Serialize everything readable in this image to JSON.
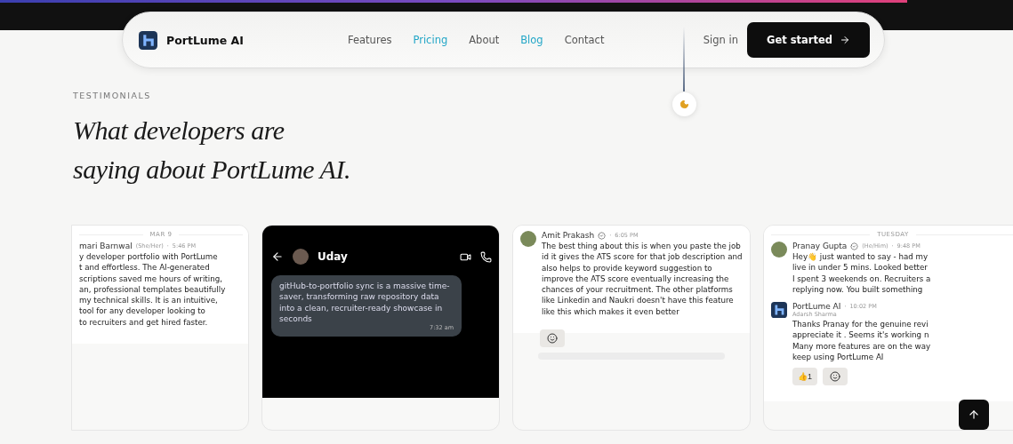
{
  "nav": {
    "brand": "PortLume AI",
    "links": [
      {
        "label": "Features",
        "active": false
      },
      {
        "label": "Pricing",
        "active": true
      },
      {
        "label": "About",
        "active": false
      },
      {
        "label": "Blog",
        "active": true
      },
      {
        "label": "Contact",
        "active": false
      }
    ],
    "sign_in": "Sign in",
    "cta": "Get started"
  },
  "section": {
    "eyebrow": "TESTIMONIALS",
    "heading": [
      "What developers are",
      "saying about PortLume AI."
    ]
  },
  "cards": [
    {
      "kind": "thread",
      "date": "MAR 9",
      "messages": [
        {
          "author": "mari Barnwal",
          "pronouns": "(She/Her)",
          "separator": "·",
          "time": "5:46 PM",
          "verified": false,
          "kind": "plain",
          "lines": [
            "y developer portfolio with PortLume",
            "t and effortless. The AI-generated",
            "scriptions saved me hours of writing,",
            "an, professional templates beautifully",
            "my technical skills. It is an intuitive,",
            "tool for any developer looking to",
            "to recruiters and get hired faster."
          ]
        }
      ]
    },
    {
      "kind": "phone",
      "contact": "Uday",
      "message": "gitHub-to-portfolio sync is a massive time-saver, transforming raw repository data into a clean, recruiter-ready showcase in seconds",
      "time": "7:32 am"
    },
    {
      "kind": "thread",
      "messages": [
        {
          "author": "Amit Prakash",
          "verified": true,
          "separator": "·",
          "time": "6:05 PM",
          "kind": "photo",
          "lines": [
            "The best thing about this is when you paste the job id it gives the ATS score for that job description and also helps to provide keyword suggestion to improve the ATS score eventually increasing the chances of your recruitment. The other platforms like Linkedin and  Naukri doesn't have this feature like this which makes it even better"
          ]
        }
      ]
    },
    {
      "kind": "thread",
      "date": "TUESDAY",
      "messages": [
        {
          "author": "Pranay Gupta",
          "verified": true,
          "pronouns": "(He/Him)",
          "separator": "·",
          "time": "9:48 PM",
          "kind": "photo",
          "lines": [
            "Hey👋 just wanted to say - had my",
            "live in under 5 mins. Looked better",
            "I spent 3 weekends on. Recruiters a",
            "replying now. You built something"
          ]
        },
        {
          "author": "PortLume AI",
          "verified": false,
          "separator": "·",
          "time": "10:02 PM",
          "kind": "logo",
          "subtitle": "Adarsh Sharma",
          "lines": [
            "Thanks Pranay for the genuine revi",
            "appreciate it . Seems it's working n",
            "Many more features are on the way",
            "keep using PortLume AI"
          ],
          "reactions": [
            {
              "emoji": "👍",
              "count": "1"
            }
          ]
        }
      ]
    }
  ]
}
